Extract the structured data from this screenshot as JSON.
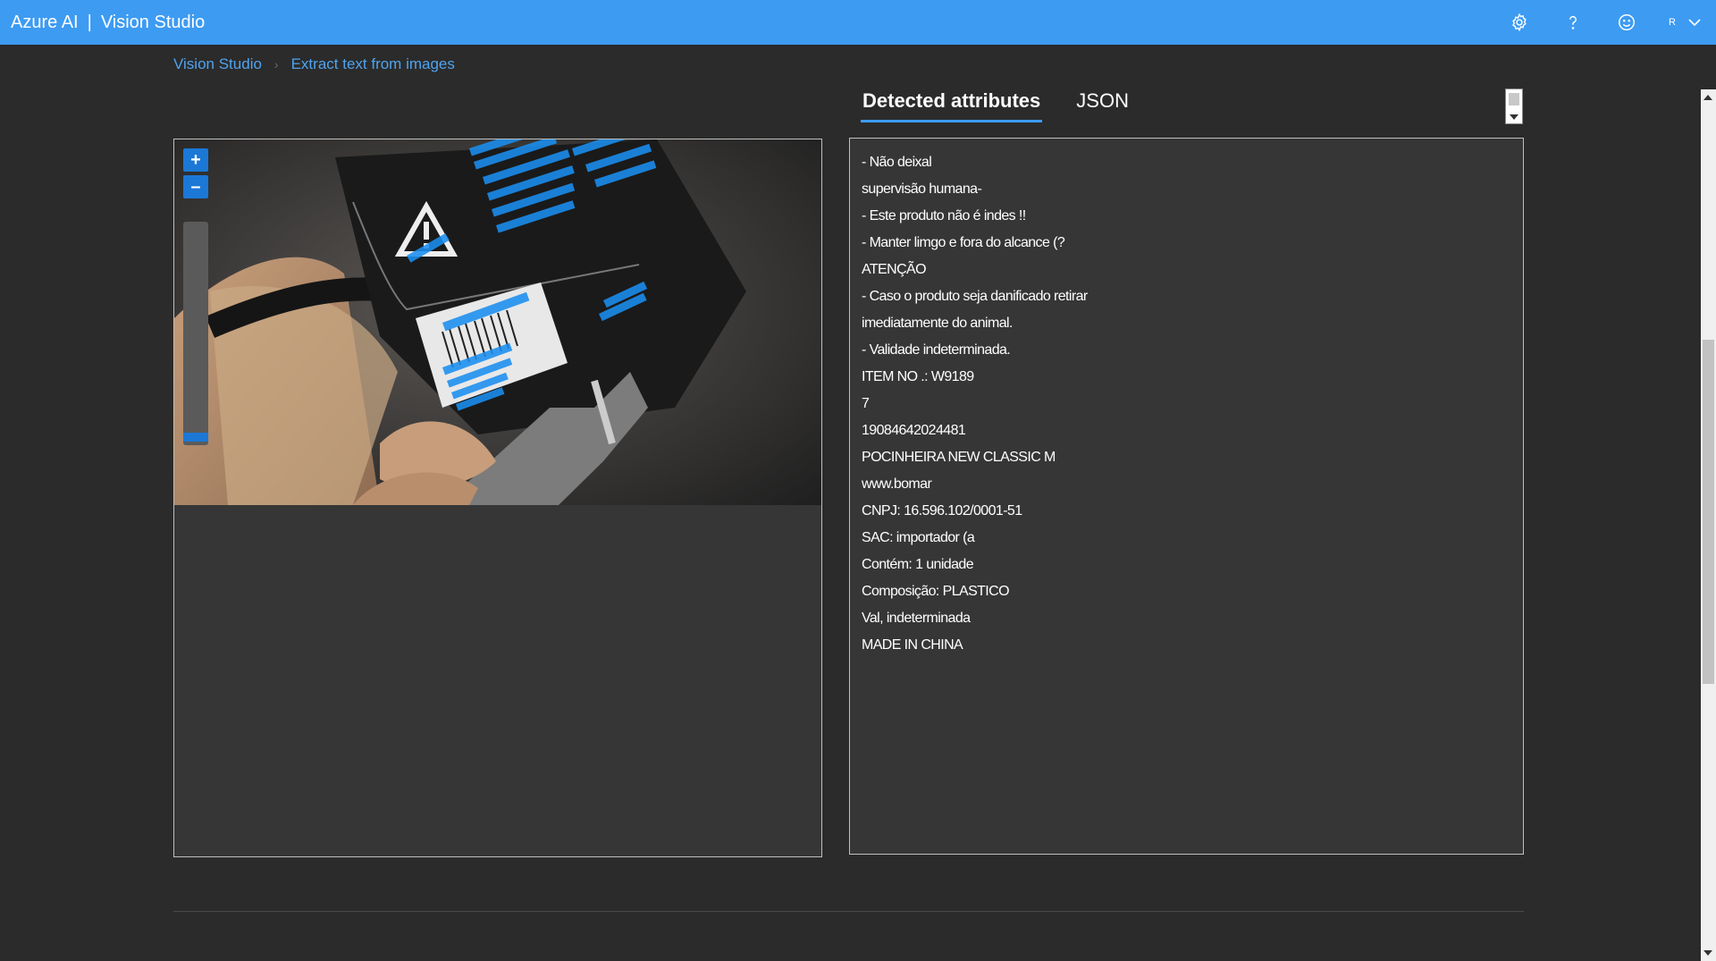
{
  "header": {
    "brand_left": "Azure AI",
    "separator": "|",
    "brand_right": "Vision Studio",
    "background_color": "#3d9bf2",
    "icons": [
      "gear-icon",
      "help-icon",
      "smiley-icon"
    ],
    "user_initial": "R"
  },
  "breadcrumb": {
    "items": [
      "Vision Studio",
      "Extract text from images"
    ]
  },
  "tabs": {
    "items": [
      "Detected attributes",
      "JSON"
    ],
    "active": "Detected attributes"
  },
  "zoom": {
    "zoom_in_label": "+",
    "zoom_out_label": "–",
    "level": 0.02
  },
  "detected_text": {
    "lines": [
      "- Não deixal",
      "supervisão humana-",
      "- Este produto não é indes !!",
      "- Manter limgo e fora do alcance (?",
      "ATENÇÃO",
      "- Caso o produto seja danificado retirar",
      "imediatamente do animal.",
      "- Validade indeterminada.",
      "ITEM NO .: W9189",
      "7",
      "19084642024481",
      "POCINHEIRA NEW CLASSIC M",
      "www.bomar",
      "CNPJ: 16.596.102/0001-51",
      "SAC: importador (a",
      "Contém: 1 unidade",
      "Composição: PLASTICO",
      "Val, indeterminada",
      "MADE IN CHINA"
    ]
  },
  "photo": {
    "warning_label": "ATENÇÃO",
    "item_label": "ITEM NO: W9189",
    "highlight_color": "#1b8ff0"
  }
}
